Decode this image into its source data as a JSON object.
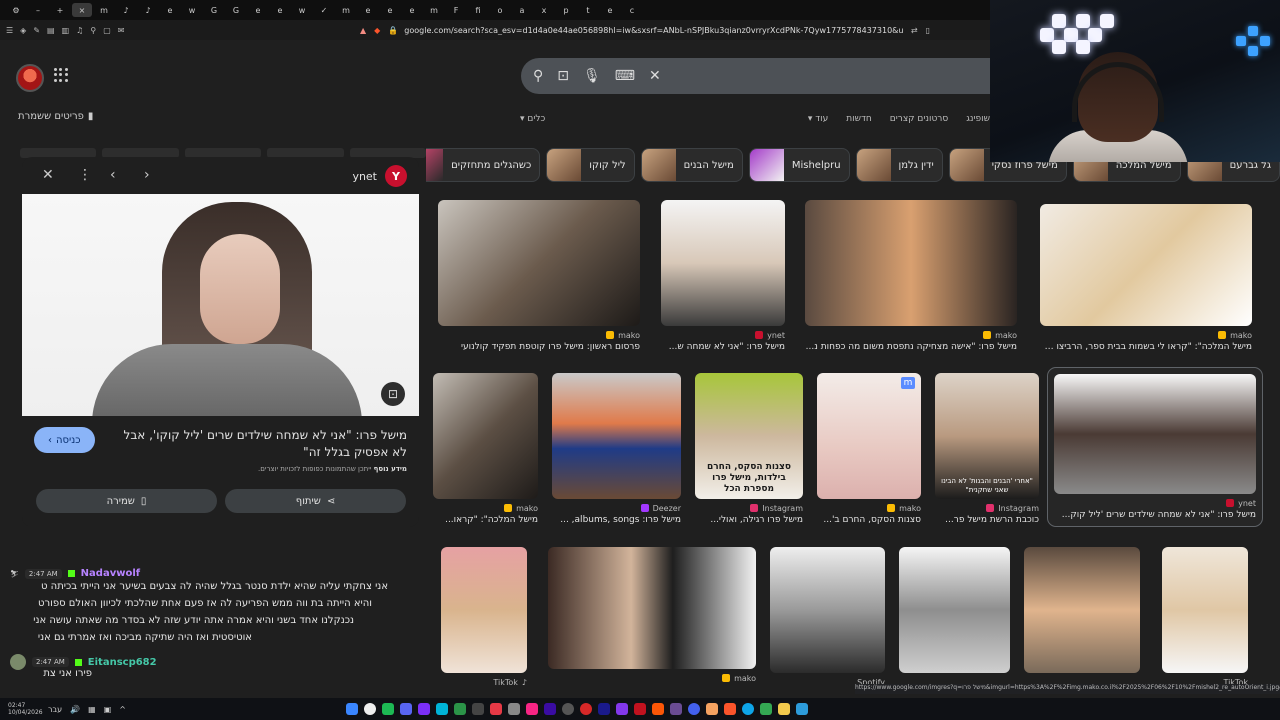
{
  "browser": {
    "tab_glyphs": [
      "⚙",
      "–",
      "+",
      "×",
      "m",
      "♪",
      "♪",
      "e",
      "w",
      "G",
      "G",
      "e",
      "e",
      "w",
      "✓",
      "m",
      "e",
      "e",
      "e",
      "m",
      "F",
      "fi",
      "o",
      "a",
      "x",
      "p",
      "t",
      "e",
      "c"
    ],
    "url": "google.com/search?sca_esv=d1d4a0e44ae056898hl=iw&sxsrf=ANbL-nSPJBku3qianz0vrryrXcdPNk-7Qyw1775778437310&udm=2&fbs=ADc_l-"
  },
  "header": {
    "saved_label": "פריטים ששמרת",
    "filters": [
      "שופינג",
      "סרטונים קצרים",
      "חדשות",
      "עוד"
    ],
    "tools_label": "כלים"
  },
  "chips": [
    {
      "label": "גל גברעם"
    },
    {
      "label": "מישל המלכה"
    },
    {
      "label": "מישל פרוז נסקי"
    },
    {
      "label": "ידין גלמן"
    },
    {
      "label": "Mishelpru"
    },
    {
      "label": "מישל הבנים"
    },
    {
      "label": "ליל קוקו"
    },
    {
      "label": "כשהגלים מתחזקים"
    }
  ],
  "panel": {
    "source": "ynet",
    "title": "מישל פרו: \"אני לא שמחה שילדים שרים 'ליל קוקו', אבל לא אפסיק בגלל זה\"",
    "visit_label": "כניסה",
    "copyright_text": "ייתכן שהתמונות כפופות לזכויות יוצרים.",
    "copyright_link": "מידע נוסף",
    "share_label": "שיתוף",
    "save_label": "שמירה"
  },
  "results": [
    {
      "src": "mako",
      "cap": "פרסום ראשון: מישל פרו קוטפת תפקיד קולנועי"
    },
    {
      "src": "ynet",
      "cap": "מישל פרו: \"אני לא שמחה ש..."
    },
    {
      "src": "mako",
      "cap": "מישל פרו: \"אישה מצחיקה נתפסת משום מה כפחות נ..."
    },
    {
      "src": "mako",
      "cap": "מישל המלכה\": \"קראו לי בשמות בבית ספר, הרביצו ל..."
    },
    {
      "src": "mako",
      "cap": "מישל המלכה\": \"קראו..."
    },
    {
      "src": "Deezer",
      "cap": "מישל פרו: albums, songs, ..."
    },
    {
      "src": "Instagram",
      "cap": "מישל פרו רגילה, ואולי..."
    },
    {
      "src": "mako",
      "cap": "סצנות הסקס, החרם ב'..."
    },
    {
      "src": "Instagram",
      "cap": "כוכבת הרשת מישל פר..."
    },
    {
      "src": "ynet",
      "cap": "מישל פרו: \"אני לא שמחה שילדים שרים 'ליל קוק..."
    },
    {
      "src": "TikTok",
      "cap": ""
    },
    {
      "src": "mako",
      "cap": ""
    },
    {
      "src": "Spotify",
      "cap": ""
    },
    {
      "src": "",
      "cap": ""
    },
    {
      "src": "",
      "cap": ""
    },
    {
      "src": "TikTok",
      "cap": ""
    }
  ],
  "overlay_texts": {
    "mako_badge": "m",
    "poster": "סצנות הסקס, החרם בילדות, מישל פרו מספרת הכל",
    "quote_thumb": "\"אחרי 'הבנים והבנות' לא הבינו שאני שחקנית\""
  },
  "chat": [
    {
      "time": "2:47 AM",
      "user": "Nadavwolf",
      "color": "#b783ff",
      "lines": [
        "אני צחקתי עליה שהיא ילדת סנטר בגלל שהיה לה צבעים בשיער אני הייתי בכיתה ט",
        "והיא הייתה בת ווה ממש הפריעה לה אז פעם אחת שהלכתי לכיוון האולם ספורט",
        "נכנקלנו אחד בשני והיא אמרה אתה יודע שזה לא בסדר מה שאתה עושה אני",
        "אוטיסטית ואז היה שתיקה מביכה ואז אמרתי גם אני"
      ]
    },
    {
      "time": "2:47 AM",
      "user": "Eitanscp682",
      "color": "#45c8a8",
      "lines": [
        "פירו אני צת"
      ]
    }
  ],
  "status_url": "https://www.google.com/imgres?q=מישל פרו&imgurl=https%3A%2F%2Fimg.mako.co.il%2F2025%2F06%2F10%2Fmishel2_re_autoOrient_i.jpg&imgrefurl=h...",
  "taskbar": {
    "time": "02:47",
    "date": "10/04/2026",
    "lang": "עבר"
  }
}
